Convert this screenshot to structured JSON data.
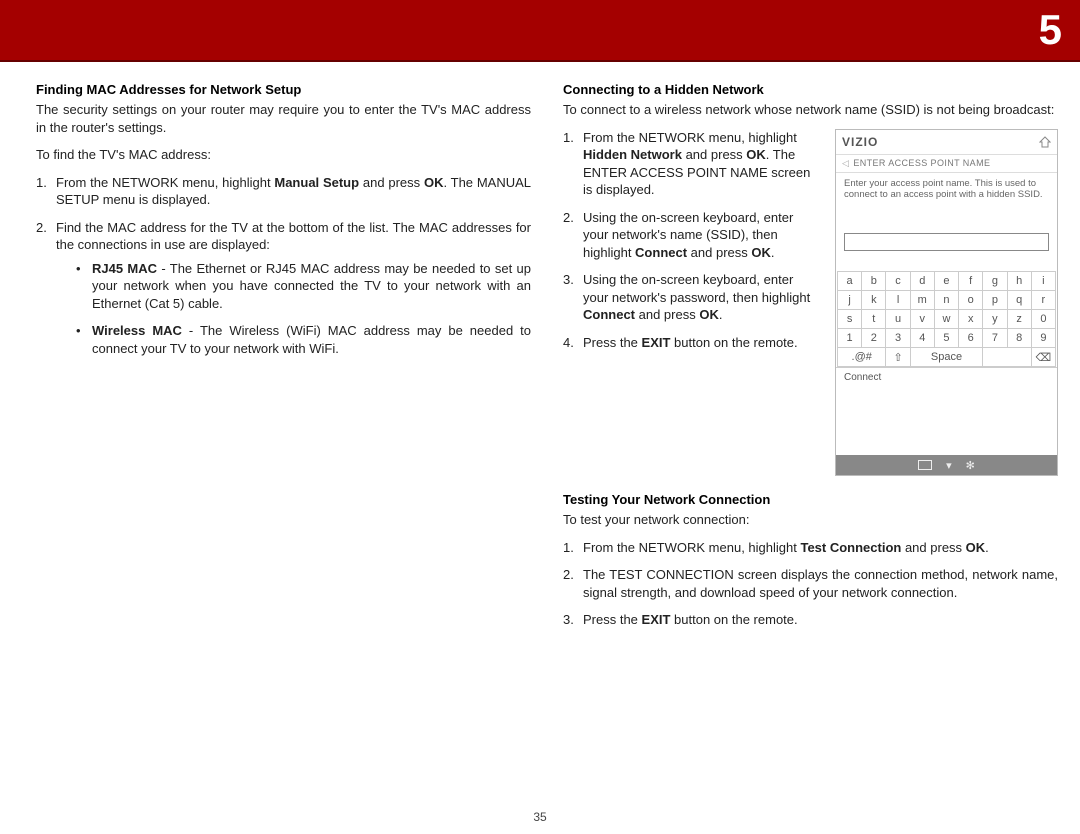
{
  "page_number_header": "5",
  "page_number_footer": "35",
  "left": {
    "h1": "Finding MAC Addresses for Network Setup",
    "p1": "The security settings on your router may require you to enter the TV's MAC address in the router's settings.",
    "p2": "To find the TV's MAC address:",
    "steps": [
      {
        "n": "1.",
        "pre": "From the NETWORK menu, highlight ",
        "b1": "Manual Setup",
        "mid": " and press ",
        "b2": "OK",
        "post": ". The MANUAL SETUP menu is displayed."
      },
      {
        "n": "2.",
        "text": "Find the MAC address for the TV at the bottom of the list. The MAC addresses for the connections in use are displayed:"
      }
    ],
    "bullets": [
      {
        "b": "RJ45 MAC",
        "text": " - The Ethernet or RJ45 MAC address may be needed to set up your network when you have connected the TV to your network with an Ethernet (Cat 5) cable."
      },
      {
        "b": "Wireless MAC",
        "text": " - The Wireless (WiFi) MAC address may be needed to connect your TV to your network with WiFi."
      }
    ]
  },
  "right": {
    "h1": "Connecting to a Hidden Network",
    "p1": "To connect to a wireless network whose network name (SSID) is not being broadcast:",
    "steps": [
      {
        "n": "1.",
        "pre": "From the NETWORK menu, highlight ",
        "b1": "Hidden Network",
        "mid": " and press ",
        "b2": "OK",
        "post": ". The ENTER ACCESS POINT NAME screen is displayed."
      },
      {
        "n": "2.",
        "pre": "Using the on-screen keyboard, enter your network's name (SSID), then highlight ",
        "b1": "Connect",
        "mid": " and press ",
        "b2": "OK",
        "post": "."
      },
      {
        "n": "3.",
        "pre": "Using the on-screen keyboard, enter your network's password, then highlight ",
        "b1": "Connect",
        "mid": " and press ",
        "b2": "OK",
        "post": "."
      },
      {
        "n": "4.",
        "pre": "Press the ",
        "b1": "EXIT",
        "mid": " button on the remote.",
        "b2": "",
        "post": ""
      }
    ],
    "testing": {
      "h": "Testing Your Network Connection",
      "p": "To test your network connection:",
      "steps": [
        {
          "n": "1.",
          "pre": "From the NETWORK menu, highlight ",
          "b1": "Test Connection",
          "mid": " and press ",
          "b2": "OK",
          "post": "."
        },
        {
          "n": "2.",
          "text": "The TEST CONNECTION screen displays the connection method, network name, signal strength, and download speed of your network connection."
        },
        {
          "n": "3.",
          "pre": "Press the ",
          "b1": "EXIT",
          "mid": " button on the remote.",
          "b2": "",
          "post": ""
        }
      ]
    }
  },
  "osd": {
    "brand": "VIZIO",
    "sub": "ENTER ACCESS POINT NAME",
    "msg": "Enter your access point name. This is used to connect to an access point with a hidden SSID.",
    "rows": [
      [
        "a",
        "b",
        "c",
        "d",
        "e",
        "f",
        "g",
        "h",
        "i"
      ],
      [
        "j",
        "k",
        "l",
        "m",
        "n",
        "o",
        "p",
        "q",
        "r"
      ],
      [
        "s",
        "t",
        "u",
        "v",
        "w",
        "x",
        "y",
        "z",
        "0"
      ],
      [
        "1",
        "2",
        "3",
        "4",
        "5",
        "6",
        "7",
        "8",
        "9"
      ]
    ],
    "row5": {
      "sym": ".@#",
      "shift": "⇧",
      "space": "Space",
      "del": "⌫"
    },
    "connect": "Connect"
  }
}
